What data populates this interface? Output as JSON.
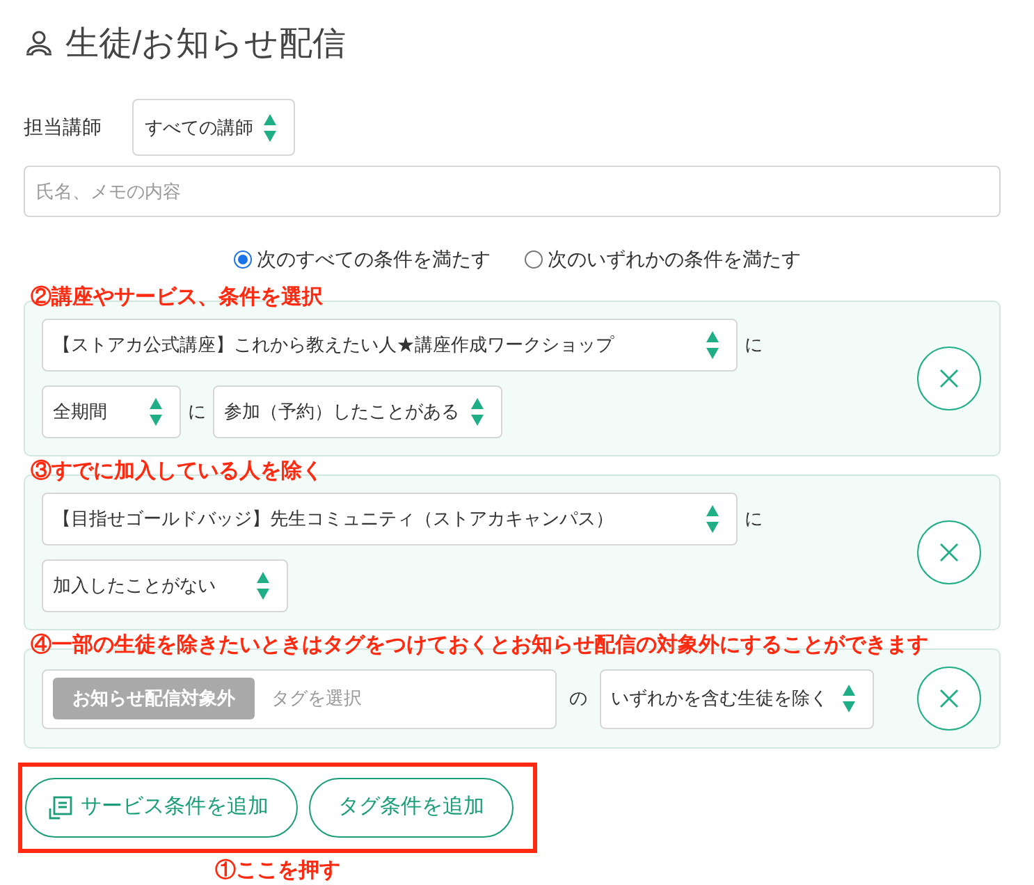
{
  "title": "生徒/お知らせ配信",
  "instructor": {
    "label": "担当講師",
    "value": "すべての講師"
  },
  "search": {
    "placeholder": "氏名、メモの内容"
  },
  "match_options": [
    {
      "label": "次のすべての条件を満たす",
      "selected": true
    },
    {
      "label": "次のいずれかの条件を満たす",
      "selected": false
    }
  ],
  "conditions": [
    {
      "kind": "service",
      "annotation": "②講座やサービス、条件を選択",
      "target": "【ストアカ公式講座】これから教えたい人★講座作成ワークショップ",
      "joiner": "に",
      "period": "全期間",
      "period_joiner": "に",
      "status": "参加（予約）したことがある"
    },
    {
      "kind": "service",
      "annotation": "③すでに加入している人を除く",
      "target": "【目指せゴールドバッジ】先生コミュニティ（ストアカキャンパス）",
      "joiner": "に",
      "status": "加入したことがない"
    },
    {
      "kind": "tag",
      "annotation": "④一部の生徒を除きたいときはタグをつけておくとお知らせ配信の対象外にすることができます",
      "tag": "お知らせ配信対象外",
      "tag_placeholder": "タグを選択",
      "joiner": "の",
      "mode": "いずれかを含む生徒を除く"
    }
  ],
  "add_buttons": [
    {
      "kind": "service",
      "label": "サービス条件を追加"
    },
    {
      "kind": "tag",
      "label": "タグ条件を追加"
    }
  ],
  "callout": "①ここを押す"
}
